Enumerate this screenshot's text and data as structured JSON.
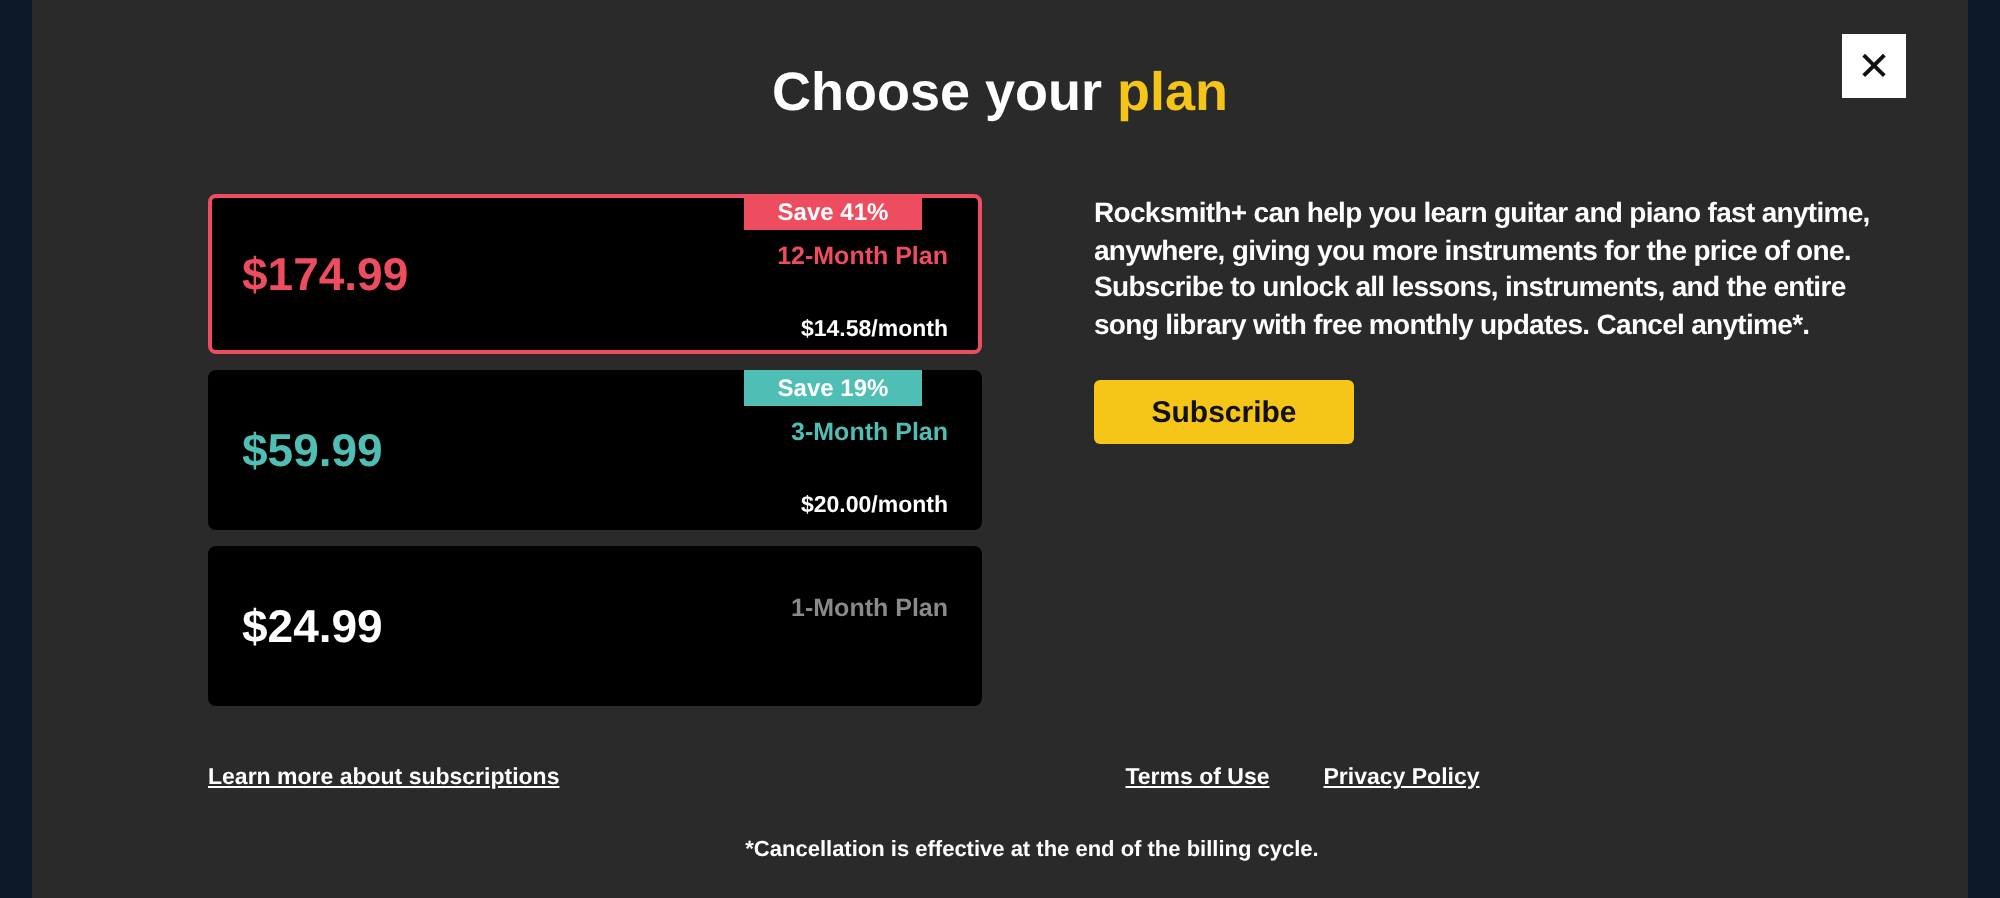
{
  "close_button": {
    "label": "✕"
  },
  "title": {
    "text": "Choose your",
    "highlight": "plan"
  },
  "plans": [
    {
      "price": "$174.99",
      "name": "12-Month Plan",
      "per_month": "$14.58/month",
      "badge": "Save 41%",
      "color": "#ee4d5f",
      "selected": true
    },
    {
      "price": "$59.99",
      "name": "3-Month Plan",
      "per_month": "$20.00/month",
      "badge": "Save 19%",
      "color": "#4fbfb5",
      "selected": false
    },
    {
      "price": "$24.99",
      "name": "1-Month Plan",
      "color": "#ffffff",
      "selected": false
    }
  ],
  "description": "Rocksmith+ can help you learn guitar and piano fast anytime, anywhere, giving you more instruments for the price of one. Subscribe to unlock all lessons, instruments, and the entire song library with free monthly updates. Cancel anytime*.",
  "subscribe_button": "Subscribe",
  "links": {
    "learn_more": "Learn more about subscriptions",
    "terms": "Terms of Use",
    "privacy": "Privacy Policy"
  },
  "footnote": "*Cancellation is effective at the end of the billing cycle."
}
